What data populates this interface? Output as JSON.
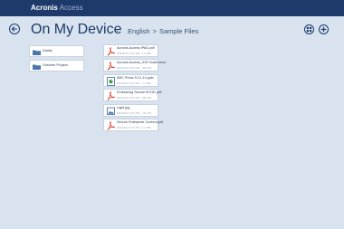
{
  "app": {
    "brand_name": "Acronis",
    "brand_product": "Access",
    "accent_color": "#1d3a6a"
  },
  "header": {
    "title": "On My Device",
    "title_chevron": "⌄",
    "breadcrumb": [
      "English",
      ">",
      "Sample Files"
    ],
    "icons": [
      "back-arrow-icon",
      "view-toggle-icon",
      "add-icon"
    ]
  },
  "folders": [
    {
      "name": "Drafts",
      "icon": "folder-icon"
    },
    {
      "name": "October Project",
      "icon": "folder-icon"
    }
  ],
  "files": [
    {
      "name": "Acronis Access iPAD.pdf",
      "meta": "8/22/2014 5:04 PM · 1.5 MB",
      "icon": "pdf-icon"
    },
    {
      "name": "Acronis Access_iOS Guide.docx",
      "meta": "8/22/2014 5:04 PM · 452 KB",
      "icon": "pdf-icon"
    },
    {
      "name": "ABC Press 5-21-14.pptx",
      "meta": "8/22/2014 5:04 PM · 2.1 MB",
      "icon": "presentation-icon"
    },
    {
      "name": "Embracing Secure BYOD.pdf",
      "meta": "8/22/2014 5:04 PM · 836 KB",
      "icon": "pdf-icon"
    },
    {
      "name": "Light.jpg",
      "meta": "8/22/2014 5:04 PM · 194 KB",
      "icon": "image-icon"
    },
    {
      "name": "Secure Enterprise Content.pdf",
      "meta": "8/22/2014 5:04 PM · 1.2 MB",
      "icon": "pdf-icon"
    }
  ]
}
